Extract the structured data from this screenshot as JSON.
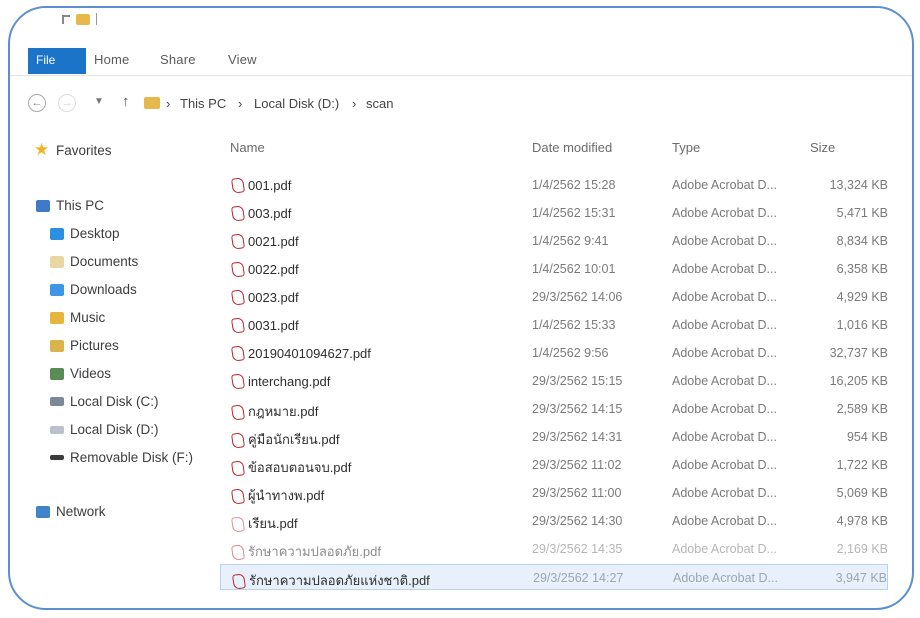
{
  "ribbon": {
    "file": "File",
    "home": "Home",
    "share": "Share",
    "view": "View"
  },
  "address": {
    "this_pc": "This PC",
    "disk": "Local Disk (D:)",
    "folder": "scan",
    "sep": "›"
  },
  "nav": {
    "favorites": "Favorites",
    "this_pc": "This PC",
    "desktop": "Desktop",
    "documents": "Documents",
    "downloads": "Downloads",
    "music": "Music",
    "pictures": "Pictures",
    "videos": "Videos",
    "disk_c": "Local Disk (C:)",
    "disk_d": "Local Disk (D:)",
    "removable": "Removable Disk (F:)",
    "network": "Network"
  },
  "columns": {
    "name": "Name",
    "date": "Date modified",
    "type": "Type",
    "size": "Size"
  },
  "files": [
    {
      "name": "001.pdf",
      "date": "1/4/2562 15:28",
      "type": "Adobe Acrobat D...",
      "size": "13,324 KB"
    },
    {
      "name": "003.pdf",
      "date": "1/4/2562 15:31",
      "type": "Adobe Acrobat D...",
      "size": "5,471 KB"
    },
    {
      "name": "0021.pdf",
      "date": "1/4/2562 9:41",
      "type": "Adobe Acrobat D...",
      "size": "8,834 KB"
    },
    {
      "name": "0022.pdf",
      "date": "1/4/2562 10:01",
      "type": "Adobe Acrobat D...",
      "size": "6,358 KB"
    },
    {
      "name": "0023.pdf",
      "date": "29/3/2562 14:06",
      "type": "Adobe Acrobat D...",
      "size": "4,929 KB"
    },
    {
      "name": "0031.pdf",
      "date": "1/4/2562 15:33",
      "type": "Adobe Acrobat D...",
      "size": "1,016 KB"
    },
    {
      "name": "20190401094627.pdf",
      "date": "1/4/2562 9:56",
      "type": "Adobe Acrobat D...",
      "size": "32,737 KB"
    },
    {
      "name": "interchang.pdf",
      "date": "29/3/2562 15:15",
      "type": "Adobe Acrobat D...",
      "size": "16,205 KB"
    },
    {
      "name": "กฎหมาย.pdf",
      "date": "29/3/2562 14:15",
      "type": "Adobe Acrobat D...",
      "size": "2,589 KB"
    },
    {
      "name": "คู่มือนักเรียน.pdf",
      "date": "29/3/2562 14:31",
      "type": "Adobe Acrobat D...",
      "size": "954 KB"
    },
    {
      "name": "ข้อสอบตอนจบ.pdf",
      "date": "29/3/2562 11:02",
      "type": "Adobe Acrobat D...",
      "size": "1,722 KB"
    },
    {
      "name": "ผู้นำทางพ.pdf",
      "date": "29/3/2562 11:00",
      "type": "Adobe Acrobat D...",
      "size": "5,069 KB"
    },
    {
      "name": "เรียน.pdf",
      "date": "29/3/2562 14:30",
      "type": "Adobe Acrobat D...",
      "size": "4,978 KB"
    },
    {
      "name": "รักษาความปลอดภัย.pdf",
      "date": "29/3/2562 14:35",
      "type": "Adobe Acrobat D...",
      "size": "2,169 KB"
    },
    {
      "name": "รักษาความปลอดภัยแห่งชาติ.pdf",
      "date": "29/3/2562 14:27",
      "type": "Adobe Acrobat D...",
      "size": "3,947 KB"
    }
  ]
}
